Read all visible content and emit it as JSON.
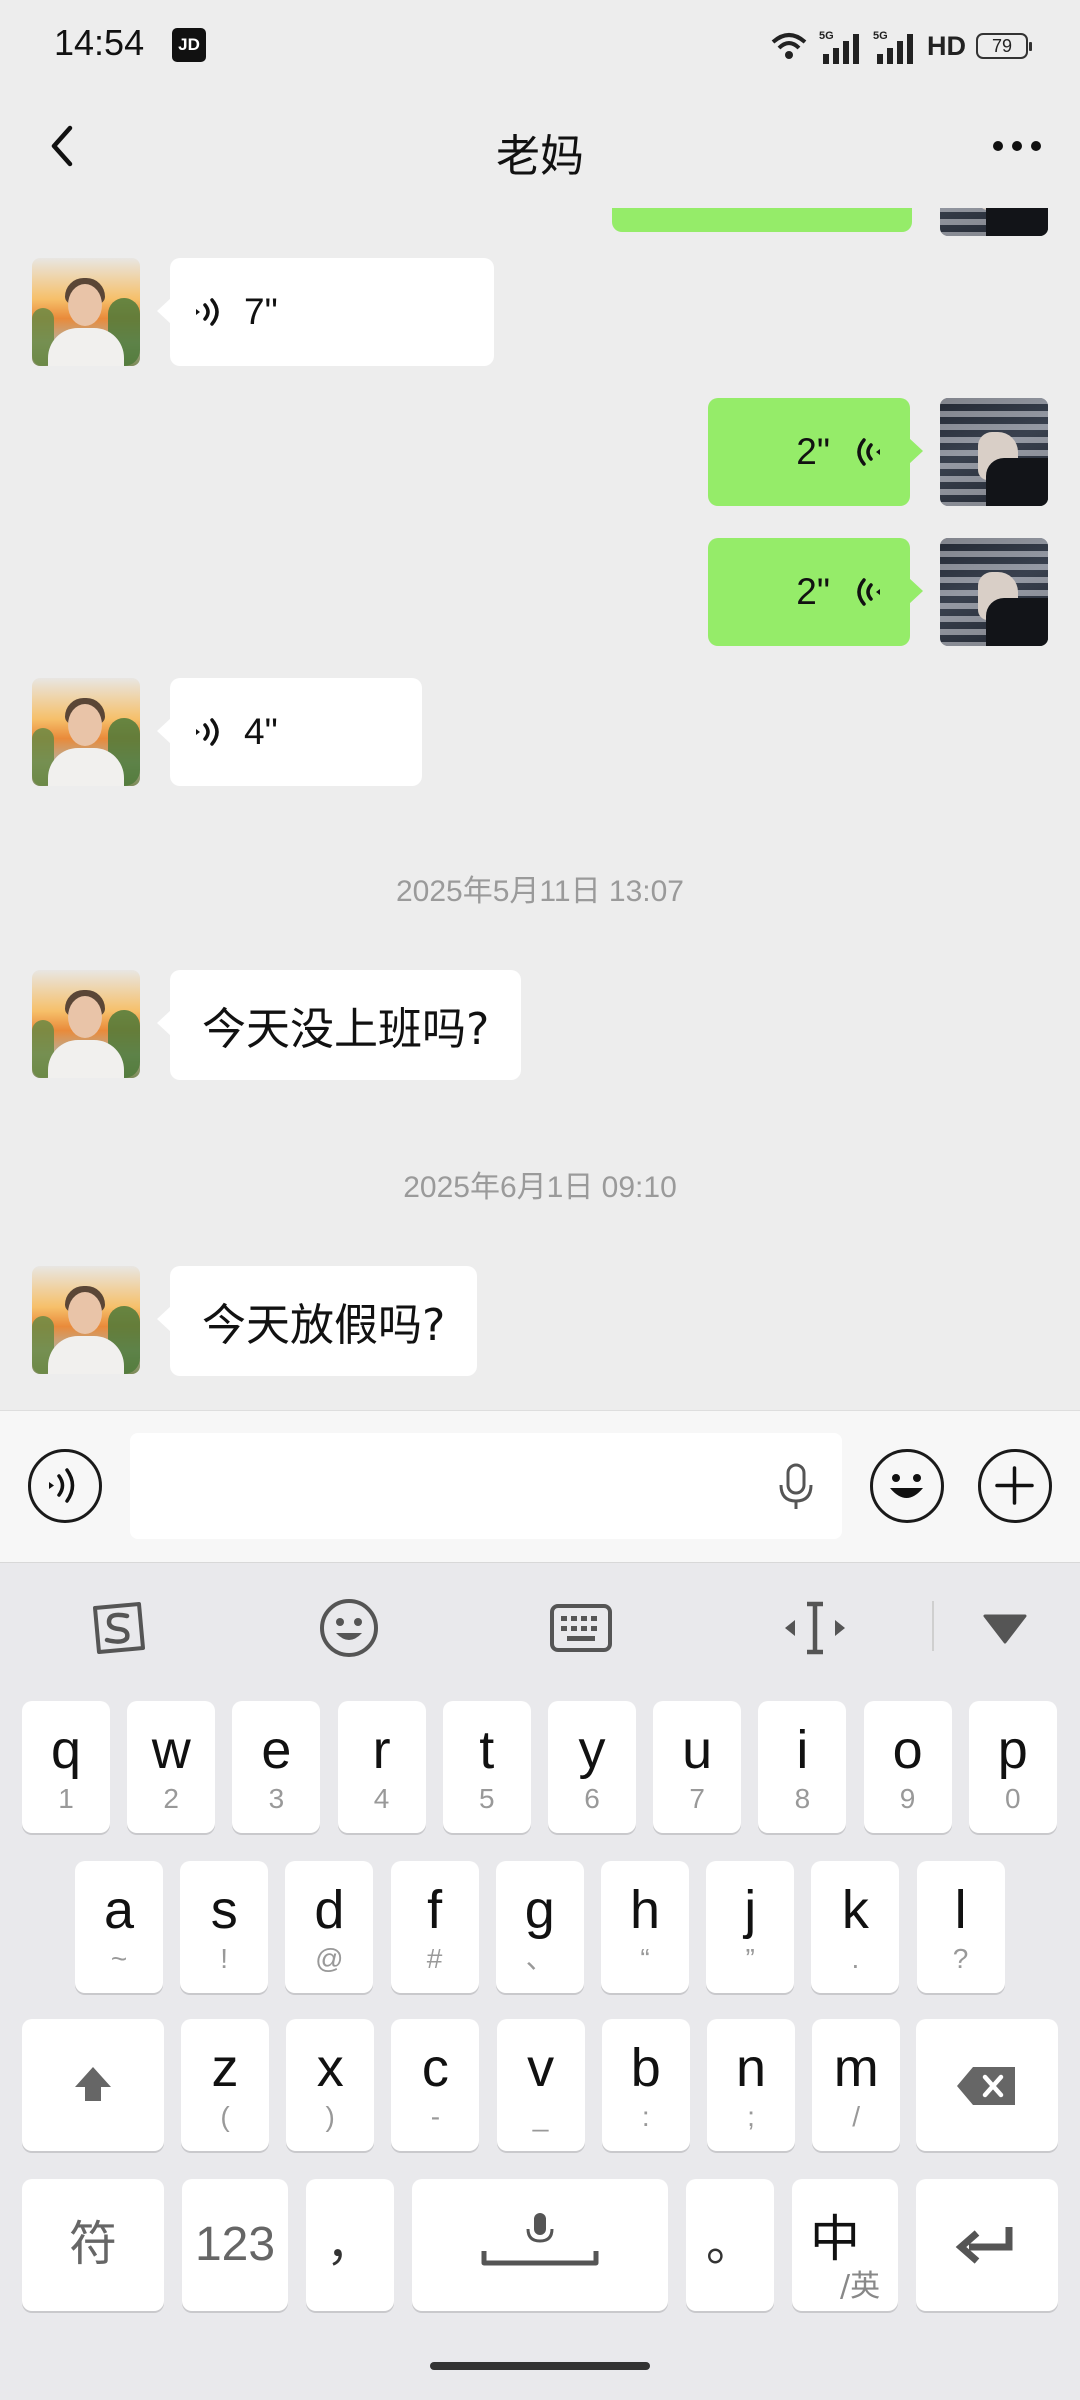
{
  "status_bar": {
    "time": "14:54",
    "jd_badge": "JD",
    "hd": "HD",
    "battery": "79"
  },
  "nav": {
    "title": "老妈",
    "back_icon": "chevron-left-icon",
    "more_icon": "more-dots-icon"
  },
  "messages": [
    {
      "side": "in",
      "type": "voice",
      "duration": "7\""
    },
    {
      "side": "out",
      "type": "voice",
      "duration": "2\""
    },
    {
      "side": "out",
      "type": "voice",
      "duration": "2\""
    },
    {
      "side": "in",
      "type": "voice",
      "duration": "4\""
    },
    {
      "type": "time",
      "text": "2025年5月11日 13:07"
    },
    {
      "side": "in",
      "type": "text",
      "text": "今天没上班吗?"
    },
    {
      "type": "time",
      "text": "2025年6月1日 09:10"
    },
    {
      "side": "in",
      "type": "text",
      "text": "今天放假吗?"
    }
  ],
  "input_bar": {
    "voice_icon": "voice-toggle-icon",
    "mic_icon": "microphone-icon",
    "emoji_icon": "emoji-icon",
    "plus_icon": "plus-icon"
  },
  "keyboard": {
    "row1": [
      {
        "k": "q",
        "s": "1"
      },
      {
        "k": "w",
        "s": "2"
      },
      {
        "k": "e",
        "s": "3"
      },
      {
        "k": "r",
        "s": "4"
      },
      {
        "k": "t",
        "s": "5"
      },
      {
        "k": "y",
        "s": "6"
      },
      {
        "k": "u",
        "s": "7"
      },
      {
        "k": "i",
        "s": "8"
      },
      {
        "k": "o",
        "s": "9"
      },
      {
        "k": "p",
        "s": "0"
      }
    ],
    "row2": [
      {
        "k": "a",
        "s": "~"
      },
      {
        "k": "s",
        "s": "!"
      },
      {
        "k": "d",
        "s": "@"
      },
      {
        "k": "f",
        "s": "#"
      },
      {
        "k": "g",
        "s": "、"
      },
      {
        "k": "h",
        "s": "“"
      },
      {
        "k": "j",
        "s": "”"
      },
      {
        "k": "k",
        "s": "."
      },
      {
        "k": "l",
        "s": "?"
      }
    ],
    "row3": [
      {
        "k": "z",
        "s": "("
      },
      {
        "k": "x",
        "s": ")"
      },
      {
        "k": "c",
        "s": "-"
      },
      {
        "k": "v",
        "s": "_"
      },
      {
        "k": "b",
        "s": ":"
      },
      {
        "k": "n",
        "s": ";"
      },
      {
        "k": "m",
        "s": "/"
      }
    ],
    "symbol_key": "符",
    "num_key": "123",
    "comma_key": "，",
    "period_key": "。",
    "lang_main": "中",
    "lang_sub": "/英"
  }
}
